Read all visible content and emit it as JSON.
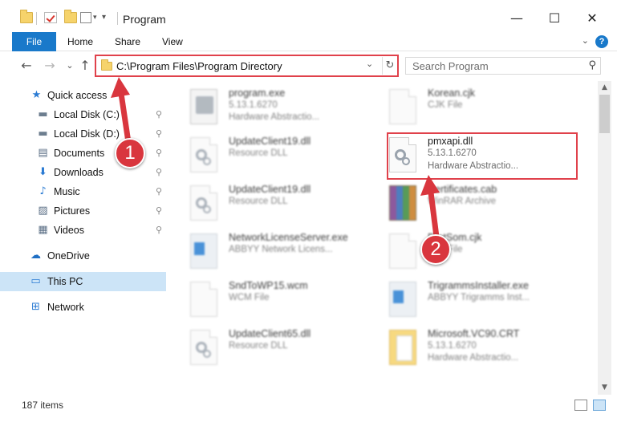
{
  "window": {
    "title": "Program",
    "minimize_glyph": "—",
    "maximize_glyph": "☐",
    "close_glyph": "✕"
  },
  "ribbon": {
    "file": "File",
    "tabs": [
      "Home",
      "Share",
      "View"
    ],
    "help_glyph": "?",
    "expand_glyph": "⌄"
  },
  "nav": {
    "back_glyph": "←",
    "forward_glyph": "→",
    "recent_glyph": "⌄",
    "up_glyph": "↑"
  },
  "address": {
    "path": "C:\\Program Files\\Program Directory",
    "dropdown_glyph": "⌄",
    "refresh_glyph": "↻"
  },
  "search": {
    "placeholder": "Search Program",
    "icon_glyph": "⚲"
  },
  "sidebar": {
    "items": [
      {
        "label": "Quick access",
        "icon": "star-icon",
        "glyph": "★",
        "color": "#2b7bd3"
      },
      {
        "label": "Local Disk (C:)",
        "icon": "drive-icon",
        "glyph": "▬",
        "color": "#6d7e8f",
        "pinned": true
      },
      {
        "label": "Local Disk (D:)",
        "icon": "drive-icon",
        "glyph": "▬",
        "color": "#6d7e8f",
        "pinned": true
      },
      {
        "label": "Documents",
        "icon": "documents-icon",
        "glyph": "▤",
        "color": "#5a6e85",
        "pinned": true
      },
      {
        "label": "Downloads",
        "icon": "downloads-icon",
        "glyph": "⬇",
        "color": "#2b7bd3",
        "pinned": true
      },
      {
        "label": "Music",
        "icon": "music-icon",
        "glyph": "♪",
        "color": "#2b7bd3",
        "pinned": true
      },
      {
        "label": "Pictures",
        "icon": "pictures-icon",
        "glyph": "▨",
        "color": "#5a6e85",
        "pinned": true
      },
      {
        "label": "Videos",
        "icon": "videos-icon",
        "glyph": "▦",
        "color": "#5a6e85",
        "pinned": true
      },
      {
        "label": "OneDrive",
        "icon": "cloud-icon",
        "glyph": "☁",
        "color": "#1f6fc4"
      },
      {
        "label": "This PC",
        "icon": "computer-icon",
        "glyph": "▭",
        "color": "#2b7bd3",
        "selected": true
      },
      {
        "label": "Network",
        "icon": "network-icon",
        "glyph": "⊞",
        "color": "#2b7bd3"
      }
    ],
    "pin_glyph": "📌"
  },
  "files": [
    {
      "name": "program.exe",
      "line1": "5.13.1.6270",
      "line2": "Hardware Abstractio...",
      "icon": "exe"
    },
    {
      "name": "Korean.cjk",
      "line1": "CJK File",
      "line2": "",
      "icon": "doc"
    },
    {
      "name": "UpdateClient19.dll",
      "line1": "Resource DLL",
      "line2": "",
      "icon": "dll"
    },
    {
      "name": "pmxapi.dll",
      "line1": "5.13.1.6270",
      "line2": "Hardware Abstractio...",
      "icon": "dll",
      "highlight": true
    },
    {
      "name": "UpdateClient19.dll",
      "line1": "Resource DLL",
      "line2": "",
      "icon": "dll"
    },
    {
      "name": "Certificates.cab",
      "line1": "WinRAR Archive",
      "line2": "",
      "icon": "archive"
    },
    {
      "name": "NetworkLicenseServer.exe",
      "line1": "ABBYY Network Licens...",
      "line2": "",
      "icon": "app"
    },
    {
      "name": "ProtSom.cjk",
      "line1": "CJK File",
      "line2": "",
      "icon": "doc"
    },
    {
      "name": "SndToWP15.wcm",
      "line1": "WCM File",
      "line2": "",
      "icon": "doc"
    },
    {
      "name": "TrigrammsInstaller.exe",
      "line1": "ABBYY Trigramms Inst...",
      "line2": "",
      "icon": "app"
    },
    {
      "name": "UpdateClient65.dll",
      "line1": "Resource DLL",
      "line2": "",
      "icon": "dll"
    },
    {
      "name": "Microsoft.VC90.CRT",
      "line1": "5.13.1.6270",
      "line2": "Hardware Abstractio...",
      "icon": "folder"
    }
  ],
  "status": {
    "count": "187 items"
  },
  "scroll": {
    "up_glyph": "▲",
    "down_glyph": "▼"
  },
  "annotations": {
    "step1": "1",
    "step2": "2",
    "color": "#d9363e"
  }
}
